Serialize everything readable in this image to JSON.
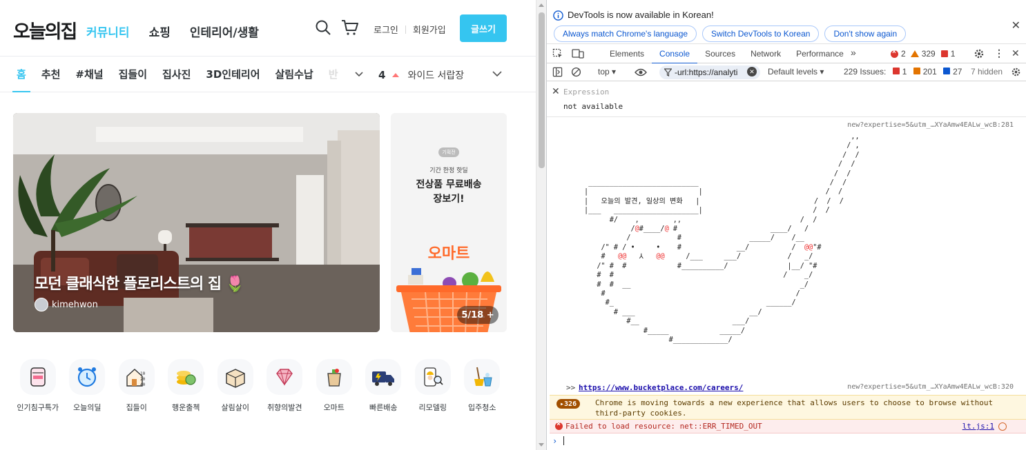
{
  "site": {
    "logo": "오늘의집",
    "main_nav": [
      "커뮤니티",
      "쇼핑",
      "인테리어/생활"
    ],
    "login": "로그인",
    "signup": "회원가입",
    "write_button": "글쓰기",
    "sub_nav": [
      "홈",
      "추천",
      "#채널",
      "집들이",
      "집사진",
      "3D인테리어",
      "살림수납",
      "반"
    ],
    "ranking": {
      "rank": "4",
      "keyword": "와이드 서랍장"
    },
    "hero": {
      "title": "모던 클래식한 플로리스트의 집 🌷",
      "user": "kimehwon"
    },
    "promo": {
      "tag": "기획전",
      "line1": "기간 한정 핫딜",
      "line2": "전상품 무료배송",
      "line3": "장보기!",
      "brand": "오마트",
      "counter": "5/18 +"
    },
    "categories": [
      "인기침구특가",
      "오늘의딜",
      "집들이",
      "행운출첵",
      "살림살이",
      "취향의발견",
      "오마트",
      "빠른배송",
      "리모델링",
      "입주청소"
    ]
  },
  "devtools": {
    "info_message": "DevTools is now available in Korean!",
    "info_buttons": [
      "Always match Chrome's language",
      "Switch DevTools to Korean",
      "Don't show again"
    ],
    "tabs": [
      "Elements",
      "Console",
      "Sources",
      "Network",
      "Performance"
    ],
    "counts": {
      "errors": "2",
      "warnings": "329",
      "issues_flag": "1"
    },
    "toolbar": {
      "context": "top",
      "filter": "-url:https://analyti",
      "levels": "Default levels",
      "issues_label": "229 Issues:",
      "issues_red": "1",
      "issues_orange": "201",
      "issues_blue": "27",
      "hidden": "7 hidden"
    },
    "expression": {
      "label": "Expression",
      "value": "not available"
    },
    "source1": "new?expertise=5&utm_…XYaAmw4EALw_wcB:281",
    "ascii_message": "오늘의 발견, 일상의 변화",
    "link_prompt": ">>",
    "careers_link": "https://www.bucketplace.com/careers/",
    "source2": "new?expertise=5&utm_…XYaAmw4EALw_wcB:320",
    "warning": {
      "badge": "326",
      "text": "Chrome is moving towards a new experience that allows users to choose to browse without third-party cookies."
    },
    "error": {
      "text": "Failed to load resource: net::ERR_TIMED_OUT",
      "link": "lt.js:1"
    }
  },
  "colors": {
    "brand": "#35c5f0",
    "devtools_blue": "#0b57d0",
    "error_red": "#dc362e",
    "warn_orange": "#e37400"
  }
}
